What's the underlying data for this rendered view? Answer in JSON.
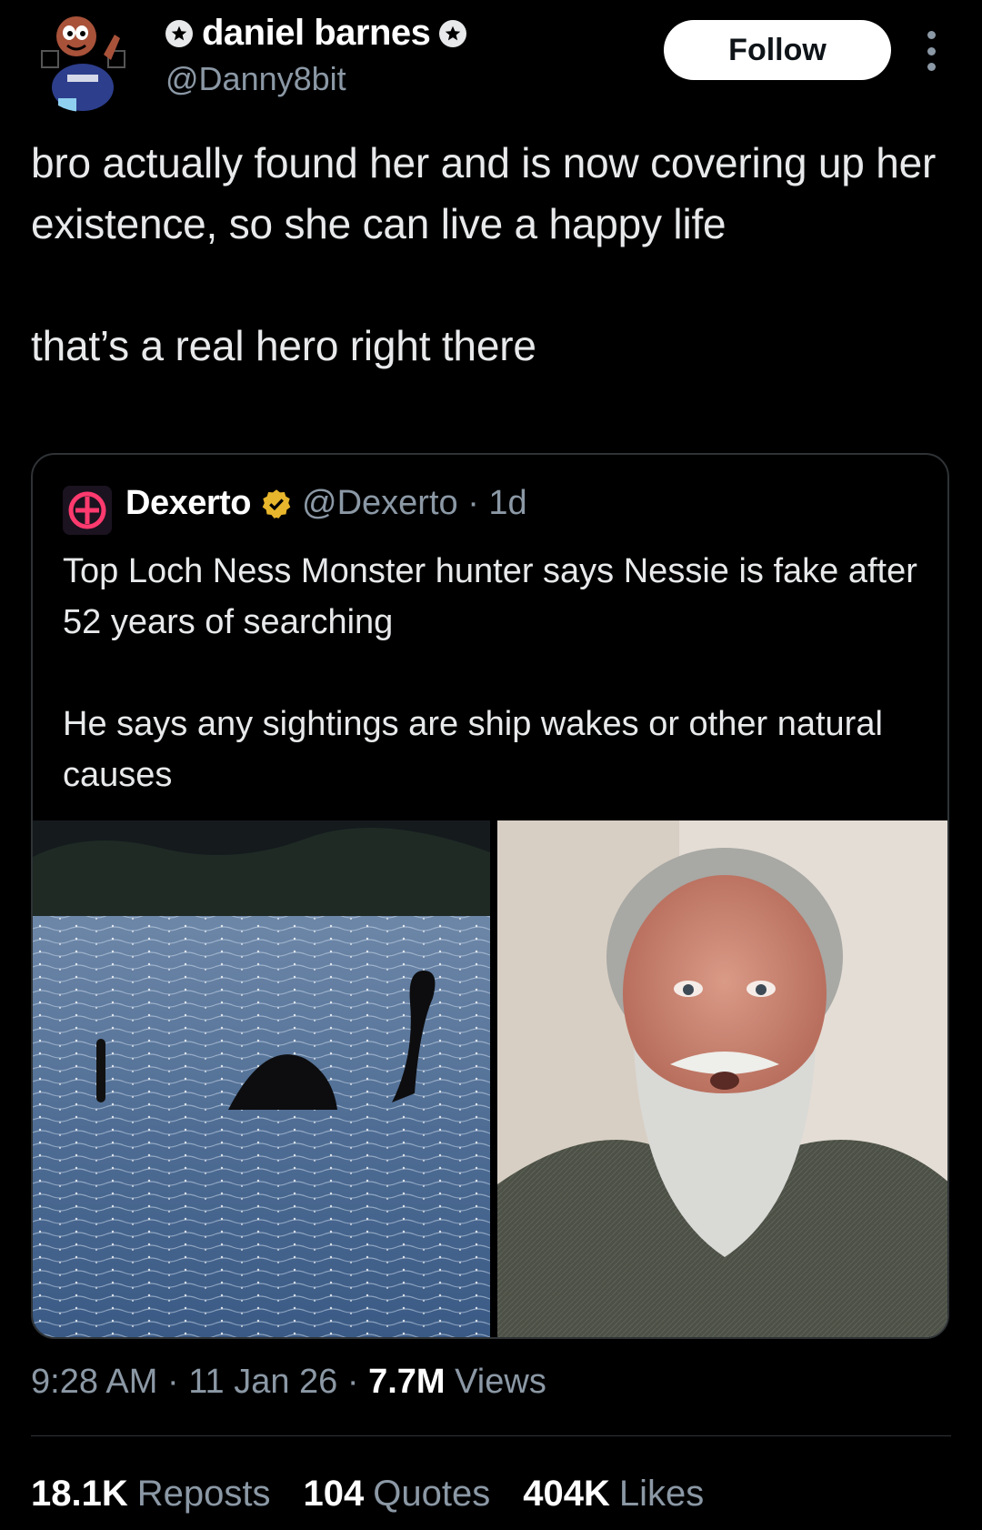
{
  "author": {
    "display_name": "daniel barnes",
    "handle": "@Danny8bit"
  },
  "follow_label": "Follow",
  "tweet": {
    "line1": "bro actually found her and is now covering up her existence, so she can live a happy life",
    "line2": "that’s a real hero right there"
  },
  "quote": {
    "name": "Dexerto",
    "handle": "@Dexerto",
    "separator": "·",
    "age": "1d",
    "text1": "Top Loch Ness Monster hunter says Nessie is fake after 52 years of searching",
    "text2": "He says any sightings are ship wakes or other natural causes"
  },
  "meta": {
    "time": "9:28 AM",
    "date": "11 Jan 26",
    "views_count": "7.7M",
    "views_label": "Views"
  },
  "stats": {
    "reposts_count": "18.1K",
    "reposts_label": "Reposts",
    "quotes_count": "104",
    "quotes_label": "Quotes",
    "likes_count": "404K",
    "likes_label": "Likes"
  },
  "colors": {
    "background": "#000000",
    "text": "#e7e9ea",
    "muted": "#8b98a5",
    "border": "#2f3336",
    "verified_gold": "#e8b62c"
  },
  "icons": [
    "star-badge-icon",
    "more-icon",
    "verified-badge-icon"
  ]
}
